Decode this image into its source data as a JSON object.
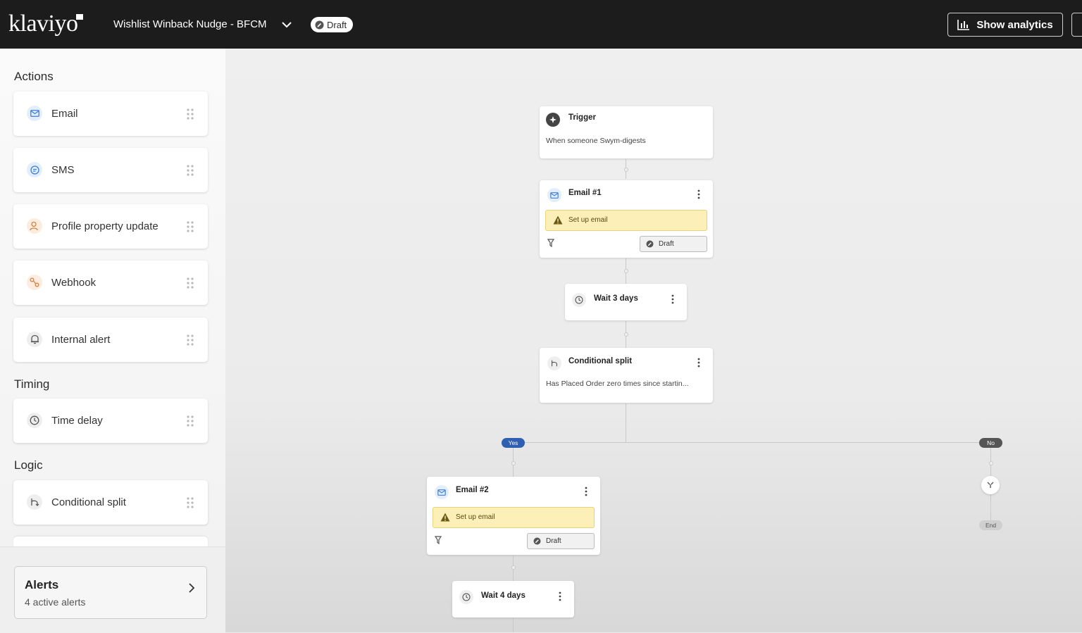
{
  "topbar": {
    "logo": "klaviyo",
    "flow_title": "Wishlist Winback Nudge - BFCM",
    "status": "Draft",
    "analytics_label": "Show analytics"
  },
  "sidebar": {
    "sections": {
      "actions": "Actions",
      "timing": "Timing",
      "logic": "Logic"
    },
    "actions": [
      {
        "label": "Email",
        "icon": "email-icon"
      },
      {
        "label": "SMS",
        "icon": "sms-icon"
      },
      {
        "label": "Profile property update",
        "icon": "profile-icon"
      },
      {
        "label": "Webhook",
        "icon": "webhook-icon"
      },
      {
        "label": "Internal alert",
        "icon": "bell-icon"
      }
    ],
    "timing": [
      {
        "label": "Time delay",
        "icon": "clock-icon"
      }
    ],
    "logic": [
      {
        "label": "Conditional split",
        "icon": "split-icon"
      }
    ],
    "alerts": {
      "title": "Alerts",
      "subtitle": "4 active alerts"
    }
  },
  "canvas": {
    "trigger": {
      "title": "Trigger",
      "subtitle": "When someone Swym-digests"
    },
    "email1": {
      "title": "Email #1",
      "warning": "Set up email",
      "status": "Draft"
    },
    "wait1": {
      "title": "Wait 3 days"
    },
    "split": {
      "title": "Conditional split",
      "subtitle": "Has Placed Order zero times since startin..."
    },
    "branch_yes": "Yes",
    "branch_no": "No",
    "end_label": "End",
    "email2": {
      "title": "Email #2",
      "warning": "Set up email",
      "status": "Draft"
    },
    "wait2": {
      "title": "Wait 4 days"
    }
  },
  "colors": {
    "topbar_bg": "#1c1c1c",
    "email_accent": "#3d7fd6",
    "warning_bg": "#fcefb8",
    "yes_pill": "#2f5fb3",
    "no_pill": "#555555"
  }
}
